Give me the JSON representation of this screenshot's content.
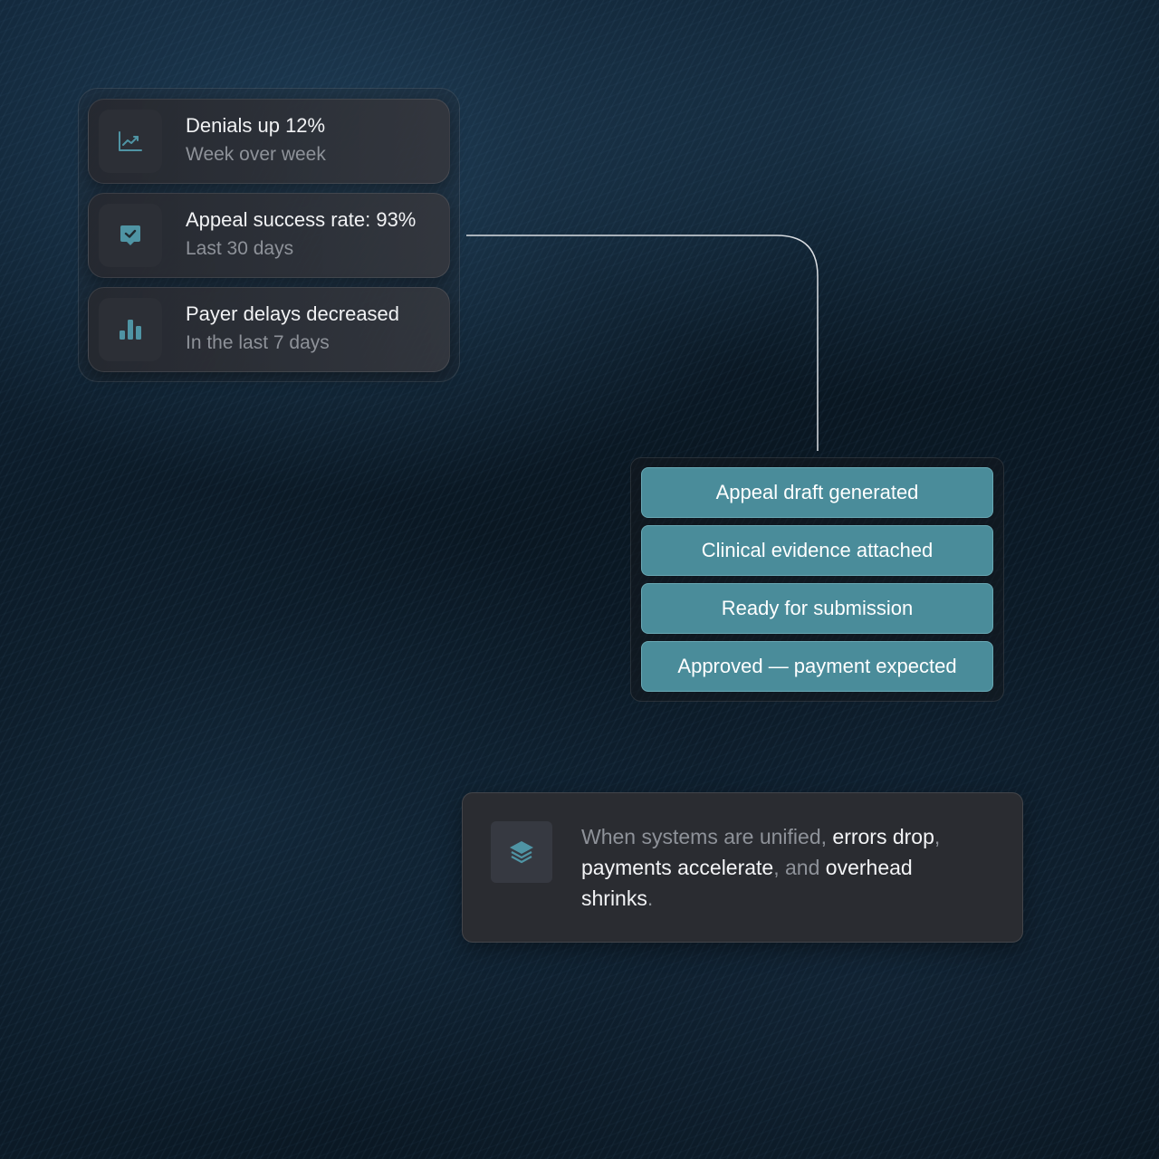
{
  "metrics": [
    {
      "icon": "line-chart-icon",
      "title": "Denials up 12%",
      "subtitle": "Week over week"
    },
    {
      "icon": "check-badge-icon",
      "title": "Appeal success rate: 93%",
      "subtitle": "Last 30 days"
    },
    {
      "icon": "bar-chart-icon",
      "title": "Payer delays decreased",
      "subtitle": "In the last 7 days"
    }
  ],
  "workflow": [
    "Appeal draft generated",
    "Clinical evidence attached",
    "Ready for submission",
    "Approved — payment expected"
  ],
  "insight": {
    "icon": "layers-icon",
    "segments": [
      {
        "text": "When systems are unified",
        "highlight": false
      },
      {
        "text": ", ",
        "highlight": false
      },
      {
        "text": "errors drop",
        "highlight": true
      },
      {
        "text": ", ",
        "highlight": false
      },
      {
        "text": "payments accelerate",
        "highlight": true
      },
      {
        "text": ", and ",
        "highlight": false
      },
      {
        "text": "overhead shrinks",
        "highlight": true
      },
      {
        "text": ".",
        "highlight": false
      }
    ]
  },
  "colors": {
    "accent_teal": "#4a8c9a",
    "icon_teal": "#4f94a4",
    "card_bg": "#2a2c31",
    "text_primary": "#f1f2f4",
    "text_muted": "#8e9299"
  }
}
